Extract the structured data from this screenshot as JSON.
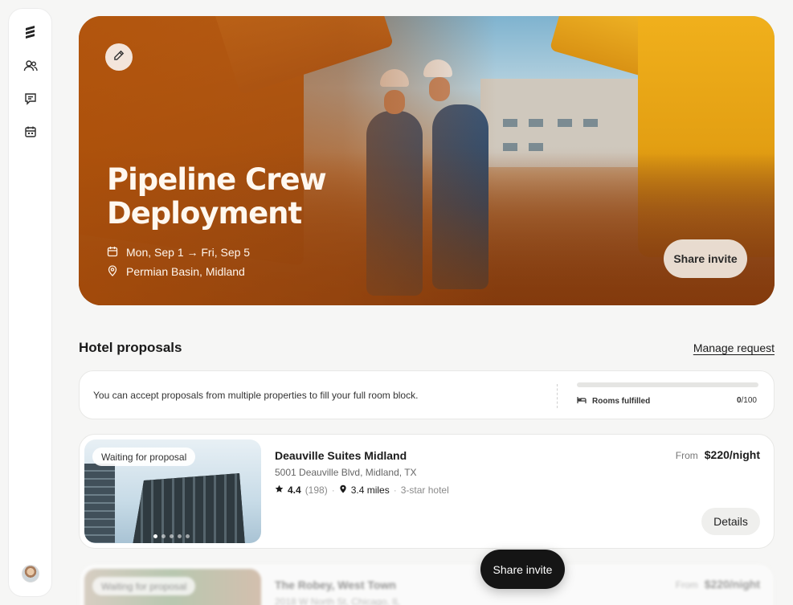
{
  "sidebar": {
    "items": [
      {
        "icon": "logo-icon"
      },
      {
        "icon": "users-icon"
      },
      {
        "icon": "message-icon"
      },
      {
        "icon": "calendar-icon"
      }
    ],
    "avatar_icon": "user-avatar"
  },
  "hero": {
    "title": "Pipeline Crew Deployment",
    "dates": "Mon, Sep 1 → Fri, Sep 5",
    "location": "Permian Basin, Midland",
    "share_label": "Share invite",
    "edit_icon": "pencil-icon"
  },
  "proposals": {
    "title": "Hotel proposals",
    "manage_label": "Manage request",
    "info_text": "You can accept proposals from multiple properties to fill your full room block.",
    "rooms_label": "Rooms fulfilled",
    "rooms_filled": "0",
    "rooms_total": "/100",
    "rooms_fraction": 0
  },
  "hotels": [
    {
      "status": "Waiting for proposal",
      "name": "Deauville Suites Midland",
      "address": "5001 Deauville Blvd, Midland, TX",
      "rating": "4.4",
      "reviews": "(198)",
      "distance": "3.4 miles",
      "class": "3-star hotel",
      "price_prefix": "From",
      "price": "$220/night",
      "details_label": "Details",
      "image_count": 5,
      "active_image": 0
    },
    {
      "status": "Waiting for proposal",
      "name": "The Robey, West Town",
      "address": "2018 W North St, Chicago, IL",
      "price_prefix": "From",
      "price": "$220/night"
    }
  ],
  "floating": {
    "share_label": "Share invite"
  },
  "colors": {
    "hero_orange": "#b5560f",
    "primary_dark": "#151515",
    "card_bg": "#ffffff",
    "page_bg": "#f6f6f5"
  }
}
